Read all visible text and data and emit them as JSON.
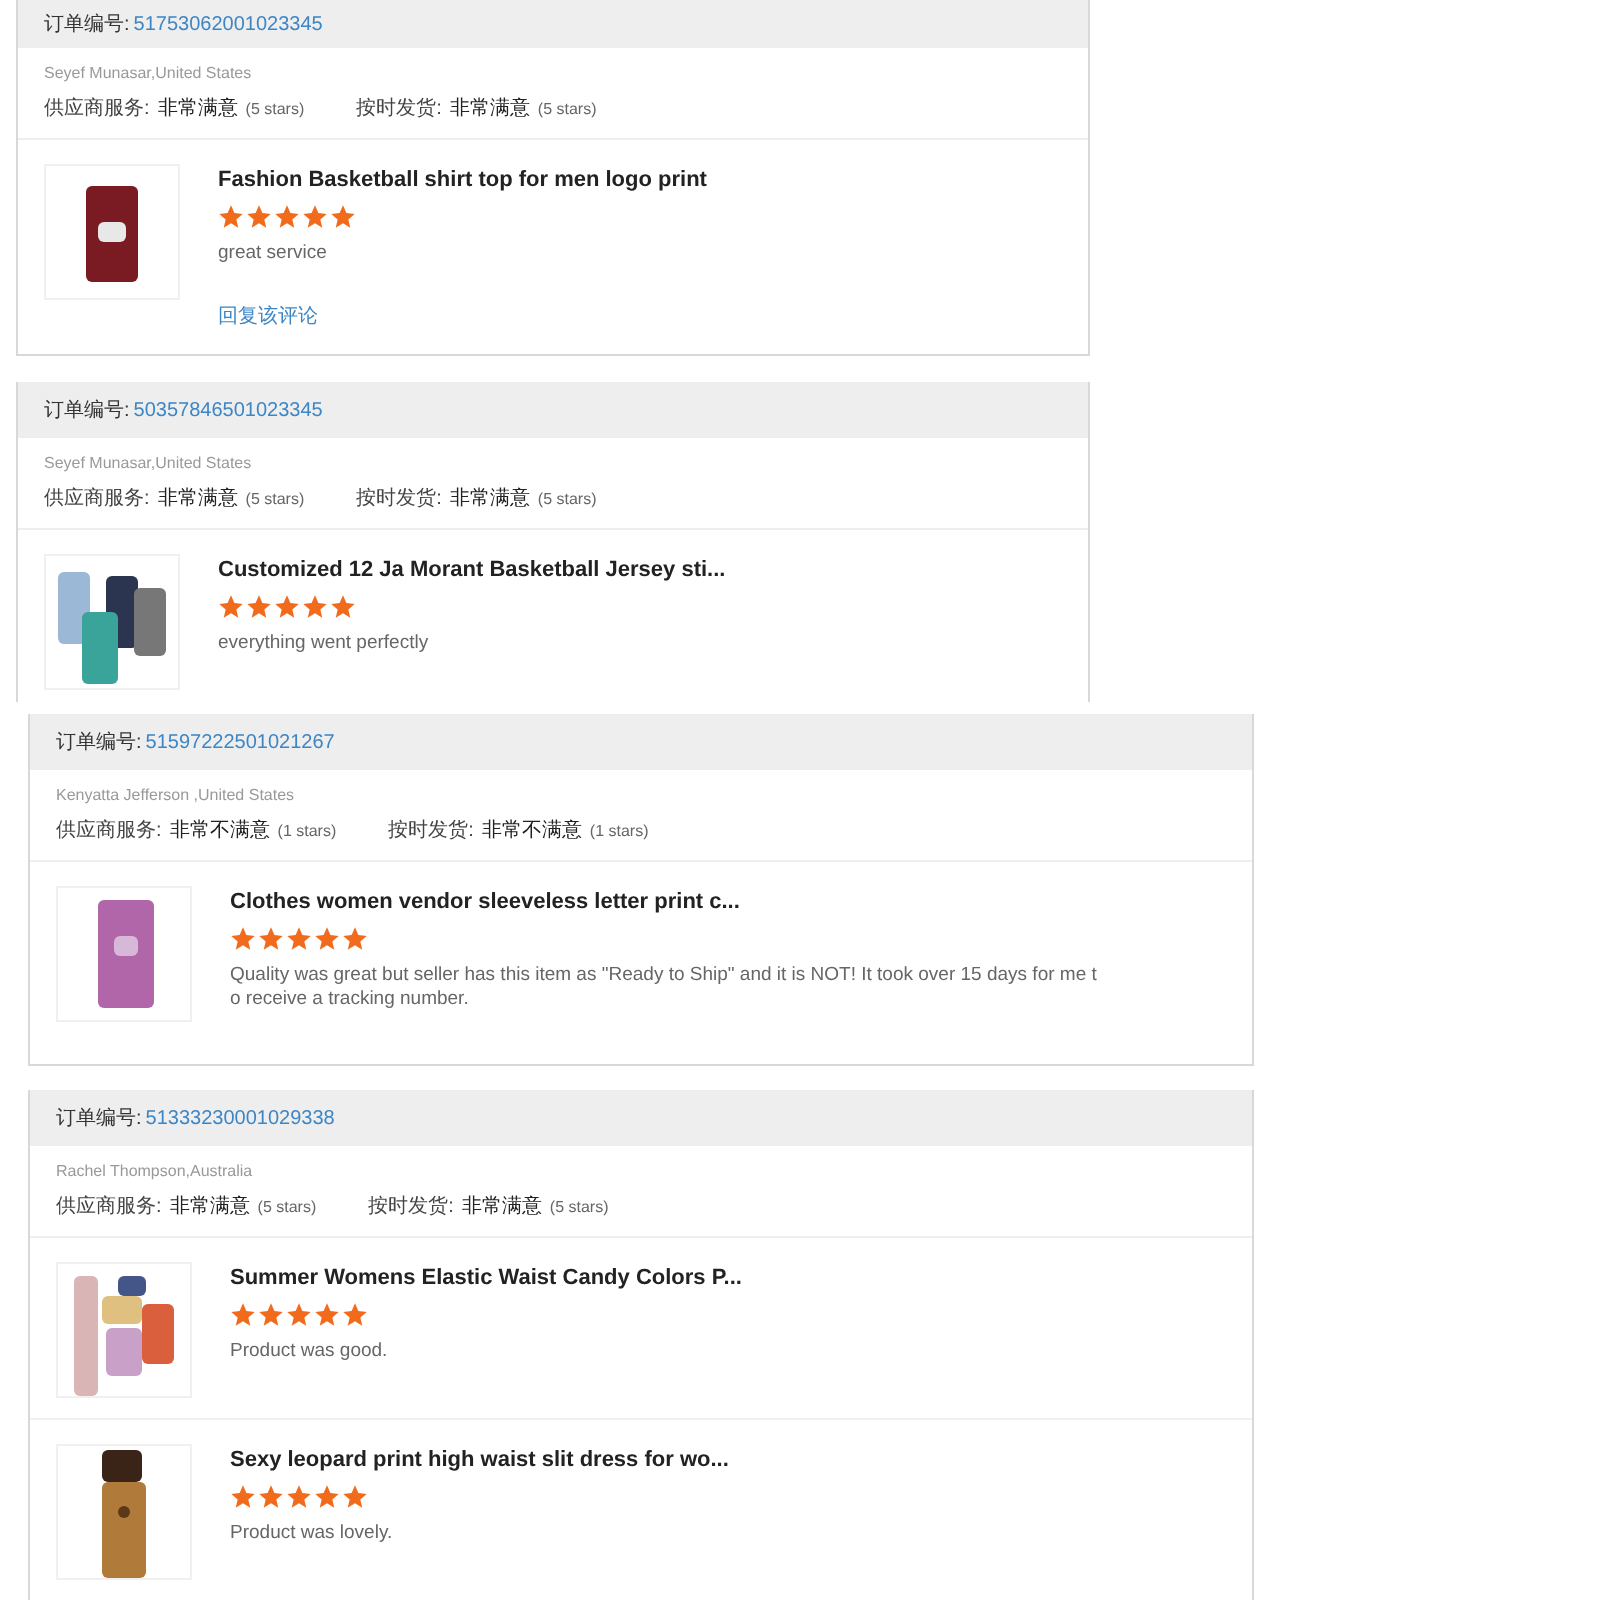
{
  "cards": [
    {
      "order_label": "订单编号:",
      "order_number": "51753062001023345",
      "buyer": "Seyef Munasar,United States",
      "ratings": [
        {
          "label": "供应商服务:",
          "value": "非常满意",
          "note": "(5 stars)"
        },
        {
          "label": "按时发货:",
          "value": "非常满意",
          "note": "(5 stars)"
        }
      ],
      "items": [
        {
          "title": "Fashion Basketball shirt top for men logo print",
          "stars": 5,
          "comment": "great service",
          "reply_link": "回复该评论"
        }
      ]
    },
    {
      "order_label": "订单编号:",
      "order_number": "50357846501023345",
      "buyer": "Seyef Munasar,United States",
      "ratings": [
        {
          "label": "供应商服务:",
          "value": "非常满意",
          "note": "(5 stars)"
        },
        {
          "label": "按时发货:",
          "value": "非常满意",
          "note": "(5 stars)"
        }
      ],
      "items": [
        {
          "title": "Customized 12 Ja Morant Basketball Jersey sti...",
          "stars": 5,
          "comment": "everything went perfectly"
        }
      ]
    },
    {
      "order_label": "订单编号:",
      "order_number": "51597222501021267",
      "buyer": "Kenyatta Jefferson ,United States",
      "ratings": [
        {
          "label": "供应商服务:",
          "value": "非常不满意",
          "note": "(1 stars)"
        },
        {
          "label": "按时发货:",
          "value": "非常不满意",
          "note": "(1 stars)"
        }
      ],
      "items": [
        {
          "title": "Clothes women vendor sleeveless letter print c...",
          "stars": 5,
          "comment": "Quality was great but seller has this item as \"Ready to Ship\" and it is NOT! It took over 15 days for me to receive a tracking number."
        }
      ]
    },
    {
      "order_label": "订单编号:",
      "order_number": "51333230001029338",
      "buyer": "Rachel Thompson,Australia",
      "ratings": [
        {
          "label": "供应商服务:",
          "value": "非常满意",
          "note": "(5 stars)"
        },
        {
          "label": "按时发货:",
          "value": "非常满意",
          "note": "(5 stars)"
        }
      ],
      "items": [
        {
          "title": "Summer Womens Elastic Waist Candy Colors P...",
          "stars": 5,
          "comment": "Product was good."
        },
        {
          "title": "Sexy leopard print high waist slit dress for wo...",
          "stars": 5,
          "comment": "Product was lovely."
        }
      ]
    }
  ]
}
